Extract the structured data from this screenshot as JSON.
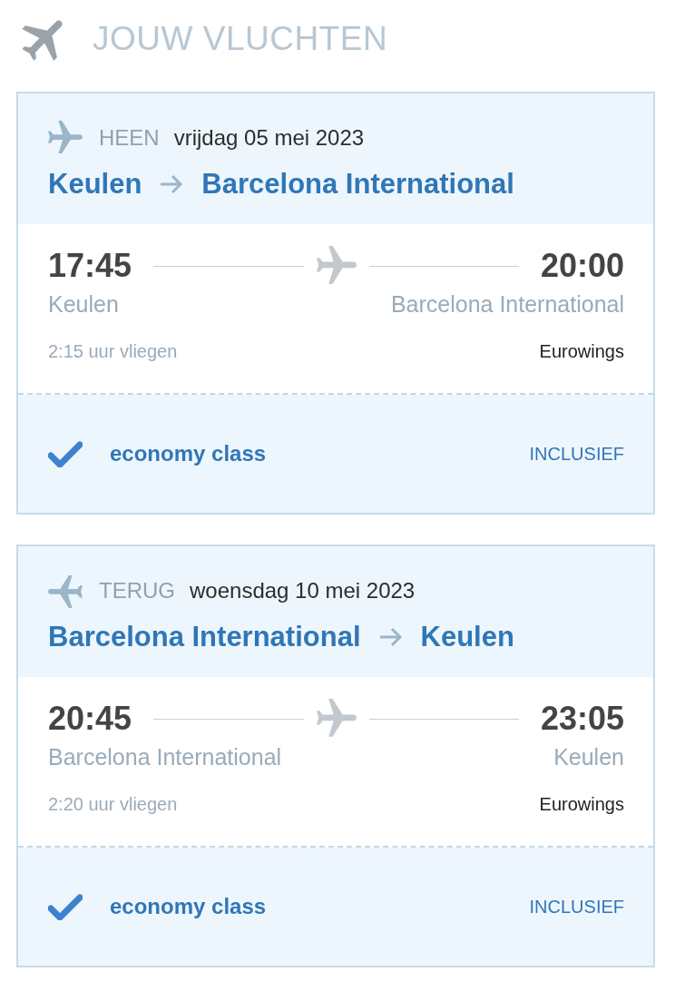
{
  "header": {
    "title": "JOUW VLUCHTEN"
  },
  "flights": [
    {
      "kind": "outbound",
      "label": "HEEN",
      "date": "vrijdag 05 mei 2023",
      "route": {
        "from": "Keulen",
        "to": "Barcelona International"
      },
      "departure": {
        "time": "17:45",
        "city": "Keulen"
      },
      "arrival": {
        "time": "20:00",
        "city": "Barcelona International"
      },
      "duration": "2:15 uur vliegen",
      "airline": "Eurowings",
      "fare": {
        "included": true,
        "name": "economy class",
        "status": "INCLUSIEF"
      }
    },
    {
      "kind": "return",
      "label": "TERUG",
      "date": "woensdag 10 mei 2023",
      "route": {
        "from": "Barcelona International",
        "to": "Keulen"
      },
      "departure": {
        "time": "20:45",
        "city": "Barcelona International"
      },
      "arrival": {
        "time": "23:05",
        "city": "Keulen"
      },
      "duration": "2:20 uur vliegen",
      "airline": "Eurowings",
      "fare": {
        "included": true,
        "name": "economy class",
        "status": "INCLUSIEF"
      }
    }
  ]
}
